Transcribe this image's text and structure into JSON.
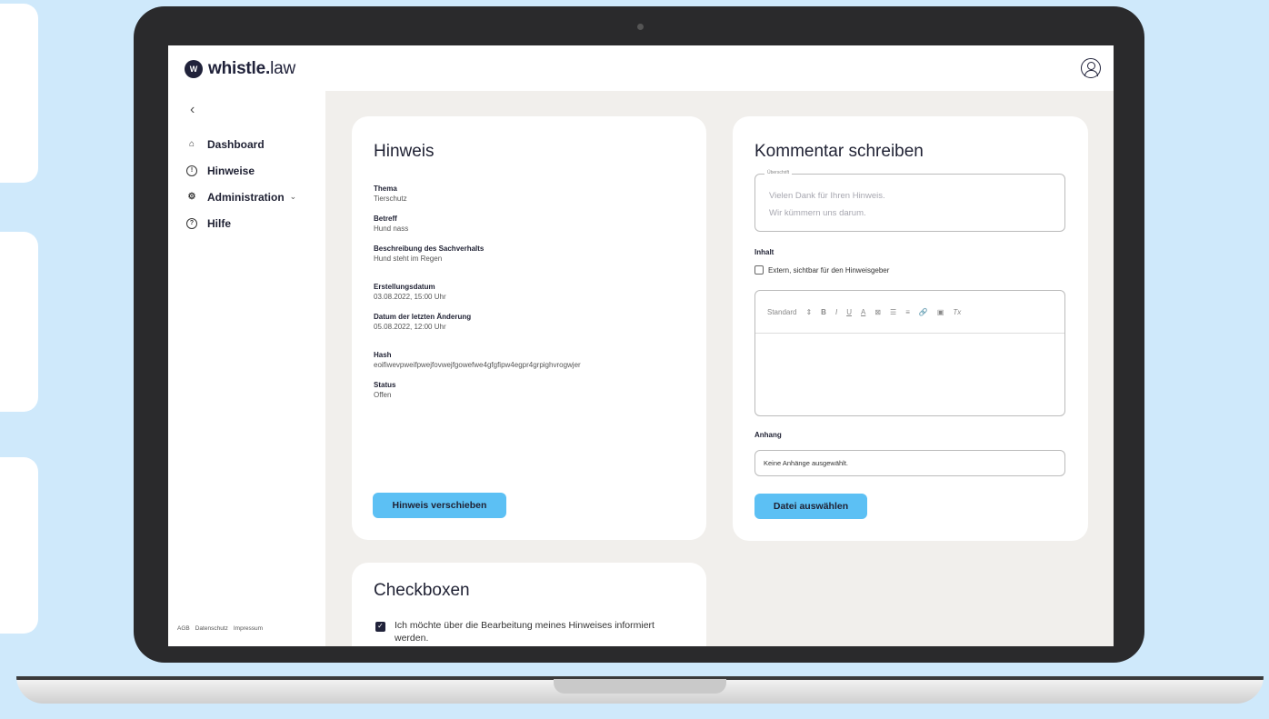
{
  "brand": {
    "logo_mark": "W",
    "name_bold": "whistle.",
    "name_rest": "law"
  },
  "sidebar": {
    "collapse_glyph": "‹",
    "items": [
      {
        "label": "Dashboard",
        "icon": "home-icon",
        "glyph": "⌂"
      },
      {
        "label": "Hinweise",
        "icon": "info-icon",
        "glyph": "!"
      },
      {
        "label": "Administration",
        "icon": "gear-icon",
        "glyph": "⚙",
        "chevron": "⌄"
      },
      {
        "label": "Hilfe",
        "icon": "help-icon",
        "glyph": "?"
      }
    ],
    "footer_links": [
      "AGB",
      "Datenschutz",
      "Impressum"
    ]
  },
  "hinweis": {
    "title": "Hinweis",
    "fields": [
      {
        "label": "Thema",
        "value": "Tierschutz"
      },
      {
        "label": "Betreff",
        "value": "Hund nass"
      },
      {
        "label": "Beschreibung des Sachverhalts",
        "value": "Hund steht im Regen"
      },
      {
        "label": "Erstellungsdatum",
        "value": "03.08.2022, 15:00 Uhr"
      },
      {
        "label": "Datum der letzten Änderung",
        "value": "05.08.2022, 12:00 Uhr"
      },
      {
        "label": "Hash",
        "value": "eoifiwevpweifpwejfovwejfgowefwe4gfgfipw4egpr4grpighvrogwjer"
      },
      {
        "label": "Status",
        "value": "Offen"
      }
    ],
    "move_button": "Hinweis verschieben"
  },
  "kommentar": {
    "title": "Kommentar schreiben",
    "heading_field_label": "Überschrift",
    "heading_placeholder_line1": "Vielen Dank für Ihren Hinweis.",
    "heading_placeholder_line2": "Wir kümmern uns darum.",
    "content_label": "Inhalt",
    "external_checkbox_label": "Extern, sichtbar für den Hinweisgeber",
    "editor_toolbar": {
      "style_select": "Standard",
      "style_select_arrow": "⇕",
      "bold": "B",
      "italic": "I",
      "underline": "U",
      "text_color": "A",
      "highlight": "⊠",
      "ordered_list": "☰",
      "bullet_list": "≡",
      "link": "🔗",
      "image": "▣",
      "clear_format": "Tx"
    },
    "attachment_label": "Anhang",
    "attachment_value": "Keine Anhänge ausgewählt.",
    "file_button": "Datei auswählen"
  },
  "checkboxen": {
    "title": "Checkboxen",
    "items": [
      {
        "label": "Ich möchte über die Bearbeitung meines Hinweises informiert werden.",
        "checked": true,
        "check_glyph": "✓"
      }
    ]
  },
  "colors": {
    "accent": "#5cc0f4",
    "background": "#cfe9fb",
    "text_dark": "#1f2133"
  }
}
